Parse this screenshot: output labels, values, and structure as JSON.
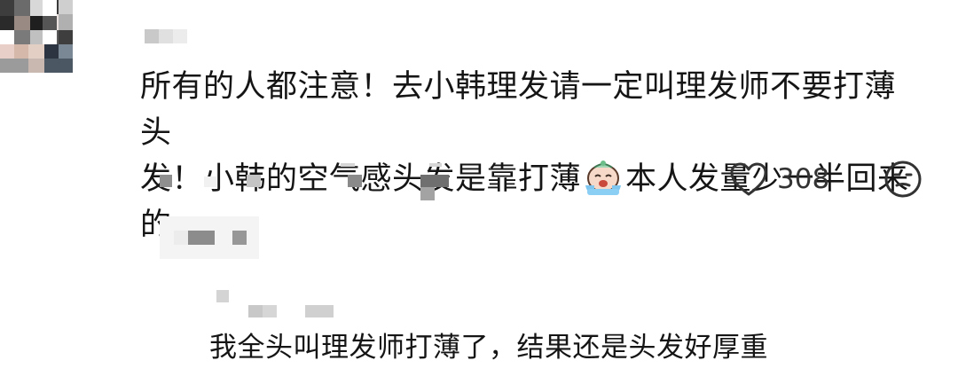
{
  "comment": {
    "text_line1": "所有的人都注意！去小韩理发请一定叫理发师不要打薄头",
    "text_line2_before": "发！小韩的空气感头发是靠打薄",
    "text_line2_after": "本人发量少一半回来的",
    "emoji_icon": "crying-emoji-icon",
    "like_count": "308",
    "like_icon": "heart-outline-icon",
    "dislike_icon": "unhappy-face-icon"
  },
  "reply": {
    "text": "我全头叫理发师打薄了，结果还是头发好厚重"
  },
  "colors": {
    "text": "#151515",
    "icon": "#333333",
    "blur_light": "#e6e6e6",
    "blur_dark": "#8a8a8a"
  }
}
